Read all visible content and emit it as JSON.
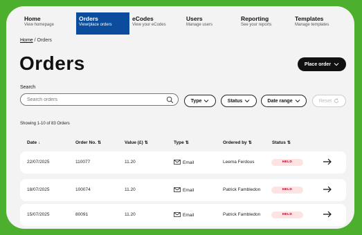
{
  "nav": {
    "items": [
      {
        "title": "Home",
        "subtitle": "View homepage"
      },
      {
        "title": "Orders",
        "subtitle": "View/place orders"
      },
      {
        "title": "eCodes",
        "subtitle": "View your eCodes"
      },
      {
        "title": "Users",
        "subtitle": "Manage users"
      },
      {
        "title": "Reporting",
        "subtitle": "See your reports"
      },
      {
        "title": "Templates",
        "subtitle": "Manage templates"
      }
    ],
    "active_index": 1
  },
  "breadcrumb": {
    "home": "Home",
    "separator": " / ",
    "current": "Orders"
  },
  "page_title": "Orders",
  "place_order_label": "Place order",
  "search": {
    "label": "Search",
    "placeholder": "Search orders",
    "value": ""
  },
  "filters": {
    "type": "Type",
    "status": "Status",
    "date_range": "Date range",
    "reset": "Reset"
  },
  "showing_text": "Showing 1-10 of 83 Orders",
  "table": {
    "columns": [
      "Date",
      "Order No.",
      "Value (£)",
      "Type",
      "Ordered by",
      "Status"
    ],
    "rows": [
      {
        "date": "22/07/2025",
        "order_no": "110077",
        "value": "11.20",
        "type": "Email",
        "ordered_by": "Leema Ferdous",
        "status": "HELD"
      },
      {
        "date": "18/07/2025",
        "order_no": "100074",
        "value": "11.20",
        "type": "Email",
        "ordered_by": "Patrick Fambledon",
        "status": "HELD"
      },
      {
        "date": "15/07/2025",
        "order_no": "80091",
        "value": "11.20",
        "type": "Email",
        "ordered_by": "Patrick Fambledon",
        "status": "HELD"
      }
    ]
  },
  "colors": {
    "background": "#4caf2e",
    "nav_active": "#0b4d9c",
    "badge_bg": "#fde3e3",
    "badge_text": "#b00020"
  }
}
